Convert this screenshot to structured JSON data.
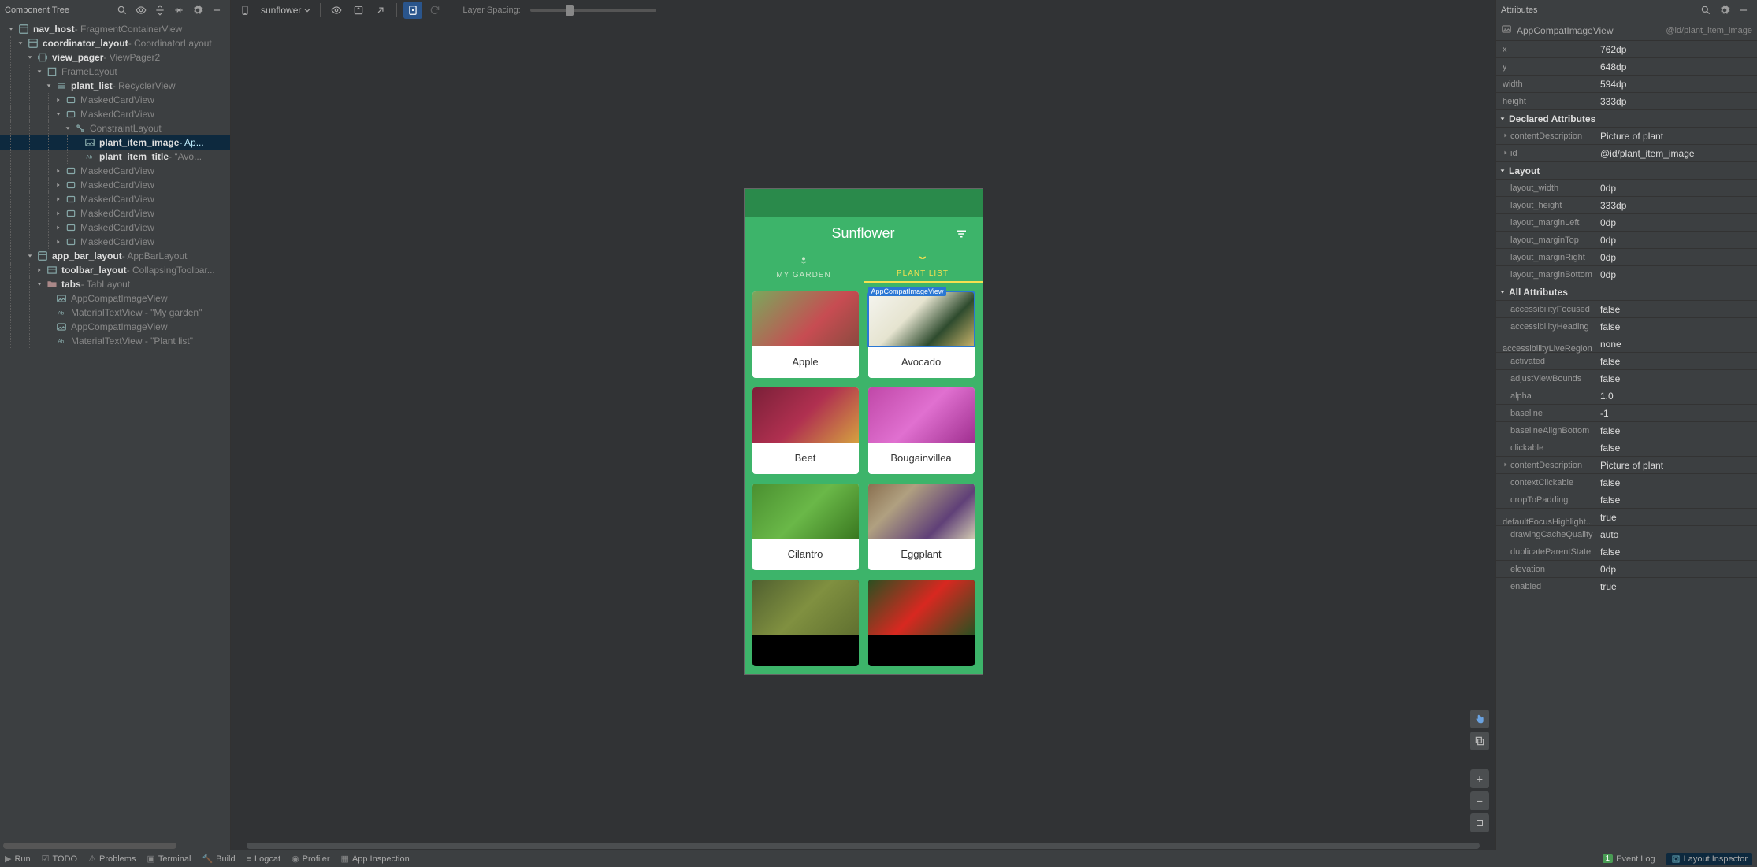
{
  "leftPanel": {
    "title": "Component Tree",
    "tree": [
      {
        "depth": 0,
        "toggle": "down",
        "icon": "layout",
        "bold": "nav_host",
        "sec": " - FragmentContainerView"
      },
      {
        "depth": 1,
        "toggle": "down",
        "icon": "layout",
        "bold": "coordinator_layout",
        "sec": " - CoordinatorLayout"
      },
      {
        "depth": 2,
        "toggle": "down",
        "icon": "pager",
        "bold": "view_pager",
        "sec": " - ViewPager2"
      },
      {
        "depth": 3,
        "toggle": "down",
        "icon": "frame",
        "bold": "",
        "sec": "FrameLayout"
      },
      {
        "depth": 4,
        "toggle": "down",
        "icon": "list",
        "bold": "plant_list",
        "sec": " - RecyclerView"
      },
      {
        "depth": 5,
        "toggle": "right",
        "icon": "card",
        "bold": "",
        "sec": "MaskedCardView"
      },
      {
        "depth": 5,
        "toggle": "down",
        "icon": "card",
        "bold": "",
        "sec": "MaskedCardView"
      },
      {
        "depth": 6,
        "toggle": "down",
        "icon": "constraint",
        "bold": "",
        "sec": "ConstraintLayout"
      },
      {
        "depth": 7,
        "toggle": "none",
        "icon": "image",
        "bold": "plant_item_image",
        "sec": " - Ap...",
        "selected": true
      },
      {
        "depth": 7,
        "toggle": "none",
        "icon": "text",
        "bold": "plant_item_title",
        "sec": " - \"Avo..."
      },
      {
        "depth": 5,
        "toggle": "right",
        "icon": "card",
        "bold": "",
        "sec": "MaskedCardView"
      },
      {
        "depth": 5,
        "toggle": "right",
        "icon": "card",
        "bold": "",
        "sec": "MaskedCardView"
      },
      {
        "depth": 5,
        "toggle": "right",
        "icon": "card",
        "bold": "",
        "sec": "MaskedCardView"
      },
      {
        "depth": 5,
        "toggle": "right",
        "icon": "card",
        "bold": "",
        "sec": "MaskedCardView"
      },
      {
        "depth": 5,
        "toggle": "right",
        "icon": "card",
        "bold": "",
        "sec": "MaskedCardView"
      },
      {
        "depth": 5,
        "toggle": "right",
        "icon": "card",
        "bold": "",
        "sec": "MaskedCardView"
      },
      {
        "depth": 2,
        "toggle": "down",
        "icon": "layout",
        "bold": "app_bar_layout",
        "sec": " - AppBarLayout"
      },
      {
        "depth": 3,
        "toggle": "right",
        "icon": "toolbar",
        "bold": "toolbar_layout",
        "sec": " - CollapsingToolbar..."
      },
      {
        "depth": 3,
        "toggle": "down",
        "icon": "folder",
        "bold": "tabs",
        "sec": " - TabLayout"
      },
      {
        "depth": 4,
        "toggle": "none",
        "icon": "image",
        "bold": "",
        "sec": "AppCompatImageView"
      },
      {
        "depth": 4,
        "toggle": "none",
        "icon": "text",
        "bold": "",
        "sec": "MaterialTextView",
        "extra": " - \"My garden\""
      },
      {
        "depth": 4,
        "toggle": "none",
        "icon": "image",
        "bold": "",
        "sec": "AppCompatImageView"
      },
      {
        "depth": 4,
        "toggle": "none",
        "icon": "text",
        "bold": "",
        "sec": "MaterialTextView",
        "extra": " - \"Plant list\""
      }
    ]
  },
  "toolbar": {
    "deviceName": "sunflower",
    "spacingLabel": "Layer Spacing:"
  },
  "device": {
    "appTitle": "Sunflower",
    "tabs": {
      "garden": "MY GARDEN",
      "plants": "PLANT LIST"
    },
    "inspectBadge": "AppCompatImageView",
    "plants": [
      {
        "title": "Apple",
        "img": "pi-apple"
      },
      {
        "title": "Avocado",
        "img": "pi-avocado",
        "selected": true
      },
      {
        "title": "Beet",
        "img": "pi-beet"
      },
      {
        "title": "Bougainvillea",
        "img": "pi-boug"
      },
      {
        "title": "Cilantro",
        "img": "pi-cilantro"
      },
      {
        "title": "Eggplant",
        "img": "pi-eggplant"
      },
      {
        "title": "",
        "img": "pi-grape",
        "cutoff": true
      },
      {
        "title": "",
        "img": "pi-hibiscus",
        "cutoff": true
      }
    ]
  },
  "rightPanel": {
    "title": "Attributes",
    "className": "AppCompatImageView",
    "idRef": "@id/plant_item_image",
    "pos": [
      {
        "name": "x",
        "value": "762dp"
      },
      {
        "name": "y",
        "value": "648dp"
      },
      {
        "name": "width",
        "value": "594dp"
      },
      {
        "name": "height",
        "value": "333dp"
      }
    ],
    "sections": [
      {
        "title": "Declared Attributes",
        "rows": [
          {
            "name": "contentDescription",
            "value": "Picture of plant",
            "expand": true
          },
          {
            "name": "id",
            "value": "@id/plant_item_image",
            "expand": true
          }
        ]
      },
      {
        "title": "Layout",
        "rows": [
          {
            "name": "layout_width",
            "value": "0dp"
          },
          {
            "name": "layout_height",
            "value": "333dp"
          },
          {
            "name": "layout_marginLeft",
            "value": "0dp"
          },
          {
            "name": "layout_marginTop",
            "value": "0dp"
          },
          {
            "name": "layout_marginRight",
            "value": "0dp"
          },
          {
            "name": "layout_marginBottom",
            "value": "0dp"
          }
        ]
      },
      {
        "title": "All Attributes",
        "rows": [
          {
            "name": "accessibilityFocused",
            "value": "false"
          },
          {
            "name": "accessibilityHeading",
            "value": "false"
          },
          {
            "name": "accessibilityLiveRegion",
            "value": "none"
          },
          {
            "name": "activated",
            "value": "false"
          },
          {
            "name": "adjustViewBounds",
            "value": "false"
          },
          {
            "name": "alpha",
            "value": "1.0"
          },
          {
            "name": "baseline",
            "value": "-1"
          },
          {
            "name": "baselineAlignBottom",
            "value": "false"
          },
          {
            "name": "clickable",
            "value": "false"
          },
          {
            "name": "contentDescription",
            "value": "Picture of plant",
            "expand": true
          },
          {
            "name": "contextClickable",
            "value": "false"
          },
          {
            "name": "cropToPadding",
            "value": "false"
          },
          {
            "name": "defaultFocusHighlight...",
            "value": "true"
          },
          {
            "name": "drawingCacheQuality",
            "value": "auto"
          },
          {
            "name": "duplicateParentState",
            "value": "false"
          },
          {
            "name": "elevation",
            "value": "0dp"
          },
          {
            "name": "enabled",
            "value": "true"
          }
        ]
      }
    ]
  },
  "bottomBar": {
    "items": [
      "Run",
      "TODO",
      "Problems",
      "Terminal",
      "Build",
      "Logcat",
      "Profiler",
      "App Inspection"
    ],
    "eventLog": "Event Log",
    "eventCount": "1",
    "layoutInspector": "Layout Inspector"
  }
}
